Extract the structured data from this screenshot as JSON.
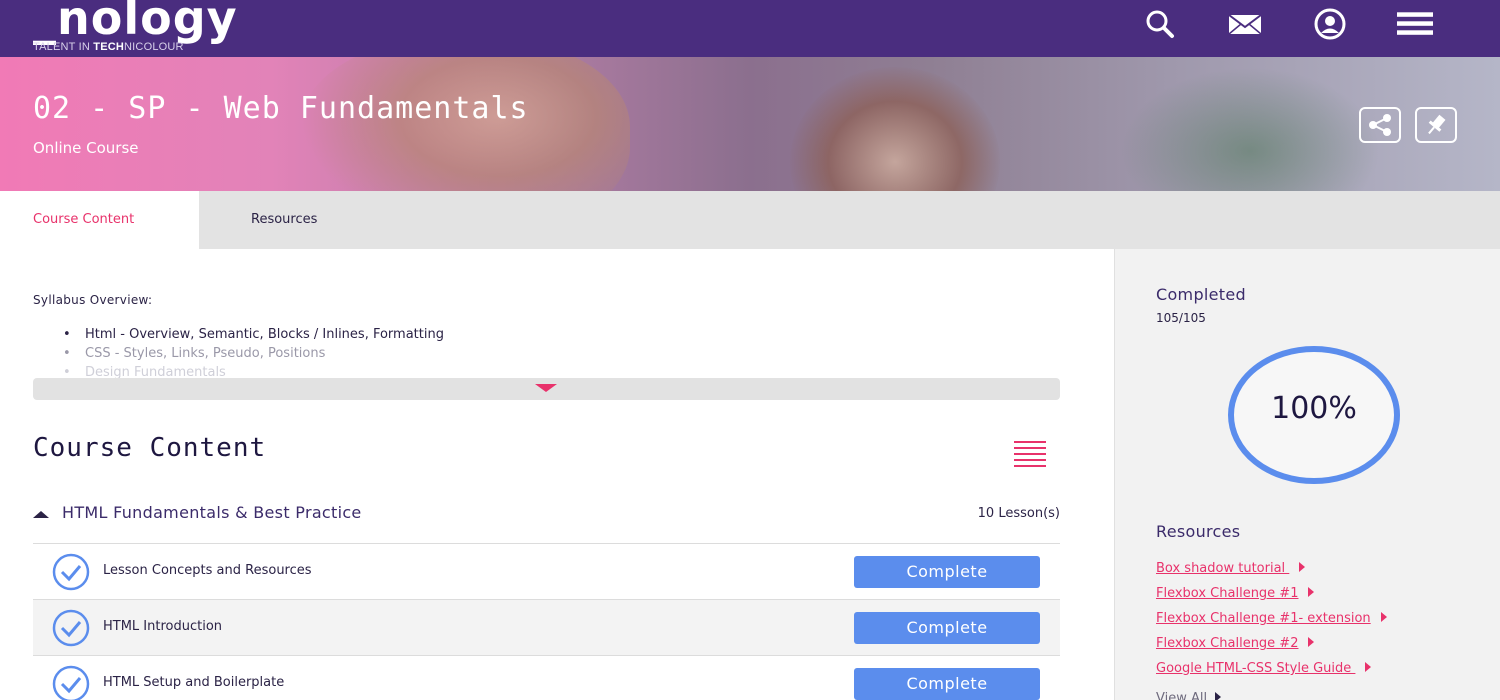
{
  "brand": {
    "logo_text": "_nology",
    "tagline_pre": "TALENT IN ",
    "tagline_bold": "TECH",
    "tagline_post": "NICOLOUR"
  },
  "nav": {
    "icons": [
      "search-icon",
      "mail-icon",
      "user-account-icon",
      "menu-icon"
    ]
  },
  "hero": {
    "title": "02 - SP - Web Fundamentals",
    "subtitle": "Online Course",
    "buttons": [
      "share-icon",
      "pin-icon"
    ]
  },
  "tabs": {
    "course_content": "Course Content",
    "resources": "Resources"
  },
  "syllabus": {
    "title": "Syllabus Overview:",
    "items": [
      "Html - Overview, Semantic, Blocks / Inlines, Formatting",
      "CSS - Styles, Links, Pseudo, Positions",
      "Design Fundamentals"
    ]
  },
  "course_content": {
    "title": "Course Content",
    "section": {
      "label": "HTML Fundamentals & Best Practice",
      "count": "10 Lesson(s)"
    },
    "lessons": [
      {
        "name": "Lesson Concepts and Resources",
        "button": "Complete"
      },
      {
        "name": "HTML Introduction",
        "button": "Complete"
      },
      {
        "name": "HTML Setup and Boilerplate",
        "button": "Complete"
      }
    ]
  },
  "sidebar": {
    "completed_title": "Completed",
    "completed_count": "105/105",
    "progress_percent": "100%",
    "progress_value": 1.0,
    "resources_title": "Resources",
    "resources": [
      "Box shadow tutorial ",
      "Flexbox Challenge #1",
      "Flexbox Challenge #1- extension",
      "Flexbox Challenge #2",
      "Google HTML-CSS Style Guide "
    ],
    "view_all": "View All"
  },
  "colors": {
    "nav_bg": "#4a2d7f",
    "accent_pink": "#e8326b",
    "button_blue": "#5b8ded",
    "ring_blue": "#5b8ded"
  }
}
